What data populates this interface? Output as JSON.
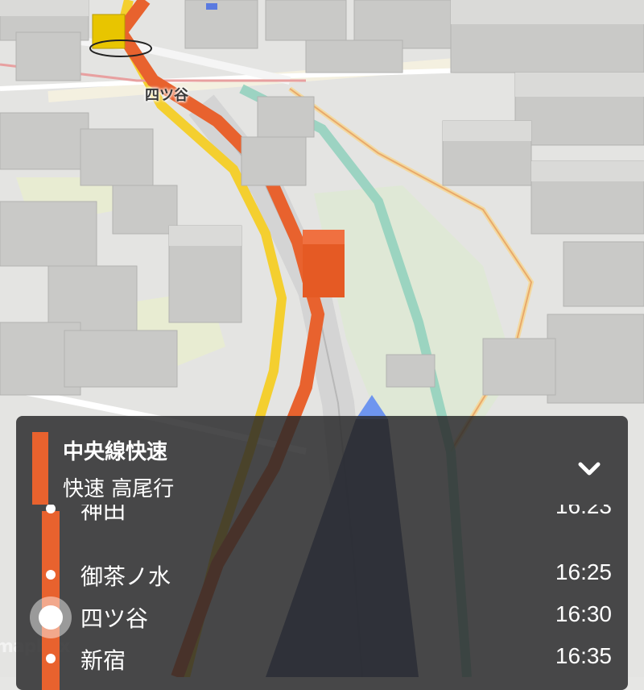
{
  "map": {
    "station_label": "四ツ谷",
    "attribution": "mapbox"
  },
  "panel": {
    "line_name": "中央線快速",
    "destination": "快速 高尾行",
    "collapse_icon": "chevron-down-icon",
    "line_color": "#e8622e",
    "stops": [
      {
        "name": "神田",
        "time": "16:23",
        "current": false
      },
      {
        "name": "御茶ノ水",
        "time": "16:25",
        "current": false
      },
      {
        "name": "四ツ谷",
        "time": "16:30",
        "current": true
      },
      {
        "name": "新宿",
        "time": "16:35",
        "current": false
      }
    ]
  }
}
